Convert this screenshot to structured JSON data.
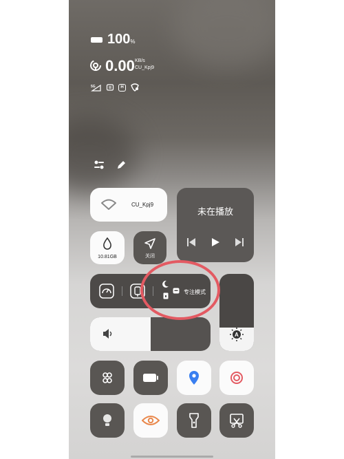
{
  "status": {
    "battery_value": "100",
    "battery_unit": "%",
    "net_speed": "0.00",
    "net_unit": "KB/s",
    "wifi_name": "CU_Kpj9",
    "icons": [
      "5g-signal-icon",
      "no-sim-icon",
      "hd-icon",
      "shield-icon"
    ],
    "hd_label": "H"
  },
  "tools": {
    "icons": [
      "sliders-icon",
      "edit-pencil-icon"
    ]
  },
  "tiles": {
    "wifi": {
      "label": "CU_Kpj9",
      "icon": "wifi-icon"
    },
    "media": {
      "title": "未在播放",
      "controls": [
        "previous-icon",
        "play-icon",
        "next-icon"
      ]
    },
    "storage": {
      "label": "10.81GB",
      "icon": "water-drop-icon"
    },
    "location": {
      "label": "关闭",
      "icon": "navigation-arrow-icon"
    },
    "focus": {
      "label": "专注模式",
      "icons": [
        "speedometer-icon",
        "mirror-icon",
        "moon-icon"
      ]
    },
    "brightness": {
      "level": 0.3,
      "icon": "auto-brightness-icon"
    },
    "volume": {
      "level": 0.5,
      "icon": "speaker-icon"
    }
  },
  "grid": [
    [
      "grid-dots-icon",
      "battery-icon",
      "location-pin-icon",
      "record-icon"
    ],
    [
      "bulb-icon",
      "eye-icon",
      "flashlight-icon",
      "screenshot-scissors-icon"
    ]
  ],
  "colors": {
    "accent_blue": "#3a7ff0",
    "accent_red": "#e35a62",
    "accent_orange": "#e9884c",
    "highlight_circle": "#e35a62"
  }
}
